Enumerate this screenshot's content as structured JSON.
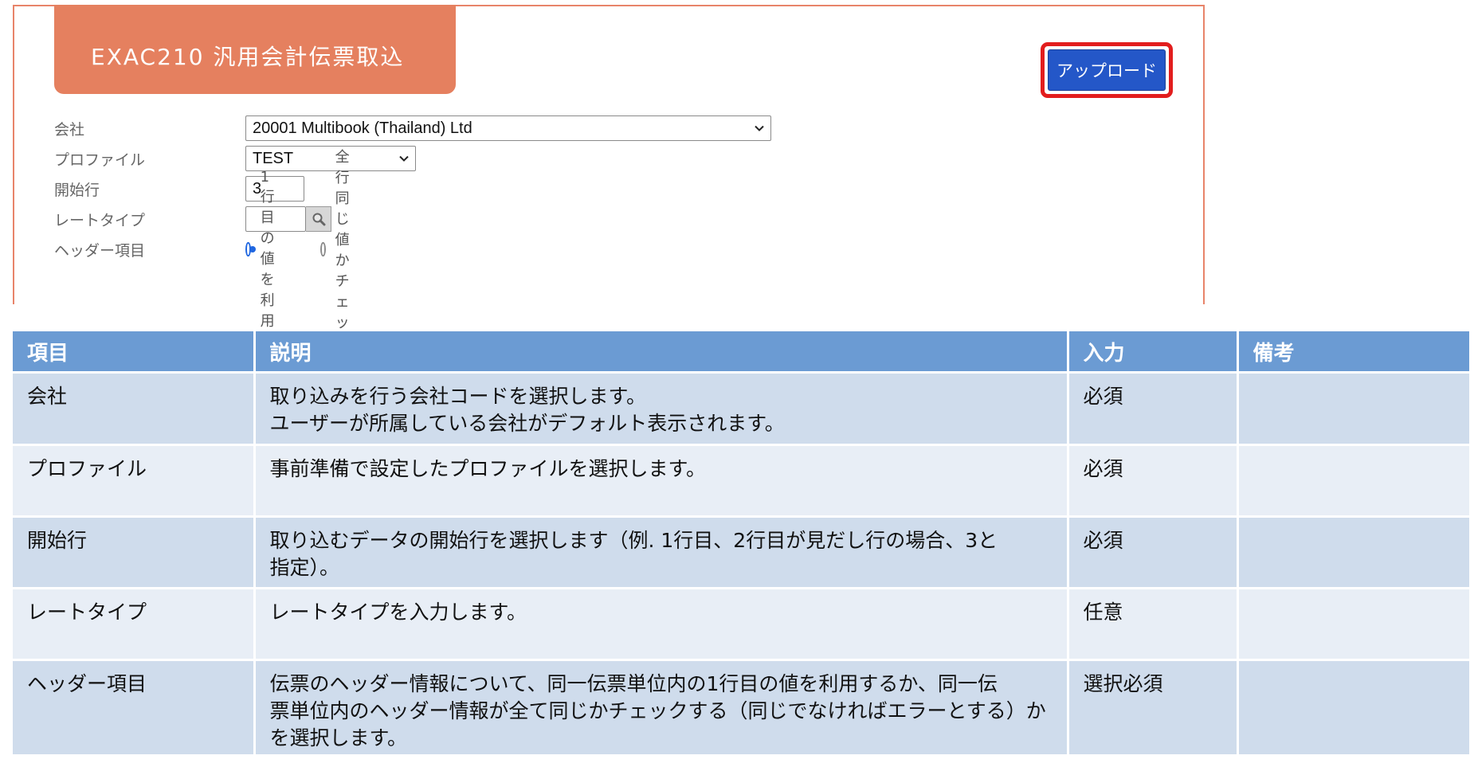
{
  "form": {
    "title": "EXAC210 汎用会計伝票取込",
    "upload_label": "アップロード",
    "fields": {
      "company": {
        "label": "会社",
        "value": "20001 Multibook (Thailand) Ltd"
      },
      "profile": {
        "label": "プロファイル",
        "value": "TEST"
      },
      "start_row": {
        "label": "開始行",
        "value": "3"
      },
      "rate_type": {
        "label": "レートタイプ",
        "value": ""
      },
      "header_item": {
        "label": "ヘッダー項目",
        "options": [
          {
            "label": "1行目の値を利用",
            "selected": true
          },
          {
            "label": "全行同じ値かチェック",
            "selected": false
          }
        ]
      }
    }
  },
  "table": {
    "headers": [
      "項目",
      "説明",
      "入力",
      "備考"
    ],
    "rows": [
      {
        "item": "会社",
        "desc": [
          "取り込みを行う会社コードを選択します。",
          "ユーザーが所属している会社がデフォルト表示されます。"
        ],
        "input": "必須",
        "note": ""
      },
      {
        "item": "プロファイル",
        "desc": [
          "事前準備で設定したプロファイルを選択します。"
        ],
        "input": "必須",
        "note": ""
      },
      {
        "item": "開始行",
        "desc": [
          "取り込むデータの開始行を選択します（例. 1行目、2行目が見だし行の場合、3と",
          "指定）。"
        ],
        "input": "必須",
        "note": ""
      },
      {
        "item": "レートタイプ",
        "desc": [
          "レートタイプを入力します。"
        ],
        "input": "任意",
        "note": ""
      },
      {
        "item": "ヘッダー項目",
        "desc": [
          "伝票のヘッダー情報について、同一伝票単位内の1行目の値を利用するか、同一伝",
          "票単位内のヘッダー情報が全て同じかチェックする（同じでなければエラーとする）か",
          "を選択します。"
        ],
        "input": "選択必須",
        "note": ""
      }
    ]
  },
  "colors": {
    "panel_border": "#e8846a",
    "title_bg": "#e5805f",
    "upload_bg": "#2457c8",
    "highlight": "#e21d1d",
    "table_header": "#6b9bd3",
    "row_dark": "#cfdcec",
    "row_light": "#e8eef6"
  },
  "icons": {
    "dropdown": "chevron-down-icon",
    "lookup": "search-icon"
  }
}
